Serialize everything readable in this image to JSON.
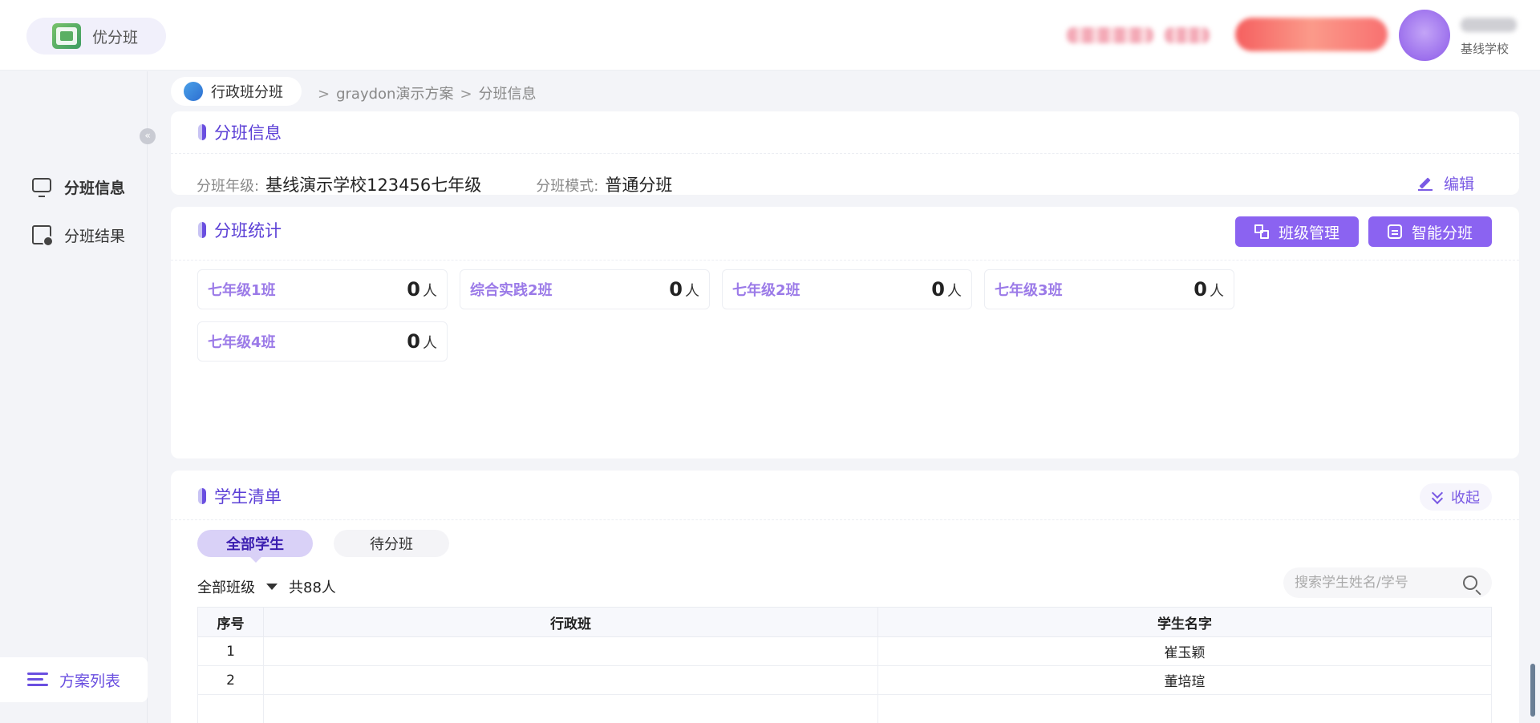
{
  "app": {
    "name": "优分班",
    "school": "基线学校"
  },
  "sidebar": {
    "collapse_glyph": "«",
    "items": [
      {
        "label": "分班信息",
        "icon": "monitor-icon",
        "active": true
      },
      {
        "label": "分班结果",
        "icon": "clipboard-icon",
        "active": false
      }
    ],
    "footer_label": "方案列表"
  },
  "breadcrumb": {
    "home": "行政班分班",
    "sep": ">",
    "plan": "graydon演示方案",
    "current": "分班信息"
  },
  "info": {
    "title": "分班信息",
    "grade_label": "分班年级:",
    "grade_value": "基线演示学校123456七年级",
    "mode_label": "分班模式:",
    "mode_value": "普通分班",
    "edit_label": "编辑"
  },
  "stats": {
    "title": "分班统计",
    "manage_label": "班级管理",
    "smart_label": "智能分班",
    "unit": "人",
    "classes": [
      {
        "name": "七年级1班",
        "count": "0"
      },
      {
        "name": "综合实践2班",
        "count": "0"
      },
      {
        "name": "七年级2班",
        "count": "0"
      },
      {
        "name": "七年级3班",
        "count": "0"
      },
      {
        "name": "七年级4班",
        "count": "0"
      }
    ]
  },
  "students": {
    "title": "学生清单",
    "collapse_label": "收起",
    "tabs": [
      "全部学生",
      "待分班"
    ],
    "filter_label": "全部班级",
    "total_label": "共88人",
    "search_placeholder": "搜索学生姓名/学号",
    "columns": [
      "序号",
      "行政班",
      "学生名字"
    ],
    "rows": [
      {
        "idx": "1",
        "admin_class": "",
        "name": "崔玉颖"
      },
      {
        "idx": "2",
        "admin_class": "",
        "name": "董培瑄"
      },
      {
        "idx": "",
        "admin_class": "",
        "name": ""
      }
    ]
  },
  "colors": {
    "accent": "#8b63f1",
    "accent_text": "#5b3fd6",
    "background": "#f3f4f8"
  }
}
